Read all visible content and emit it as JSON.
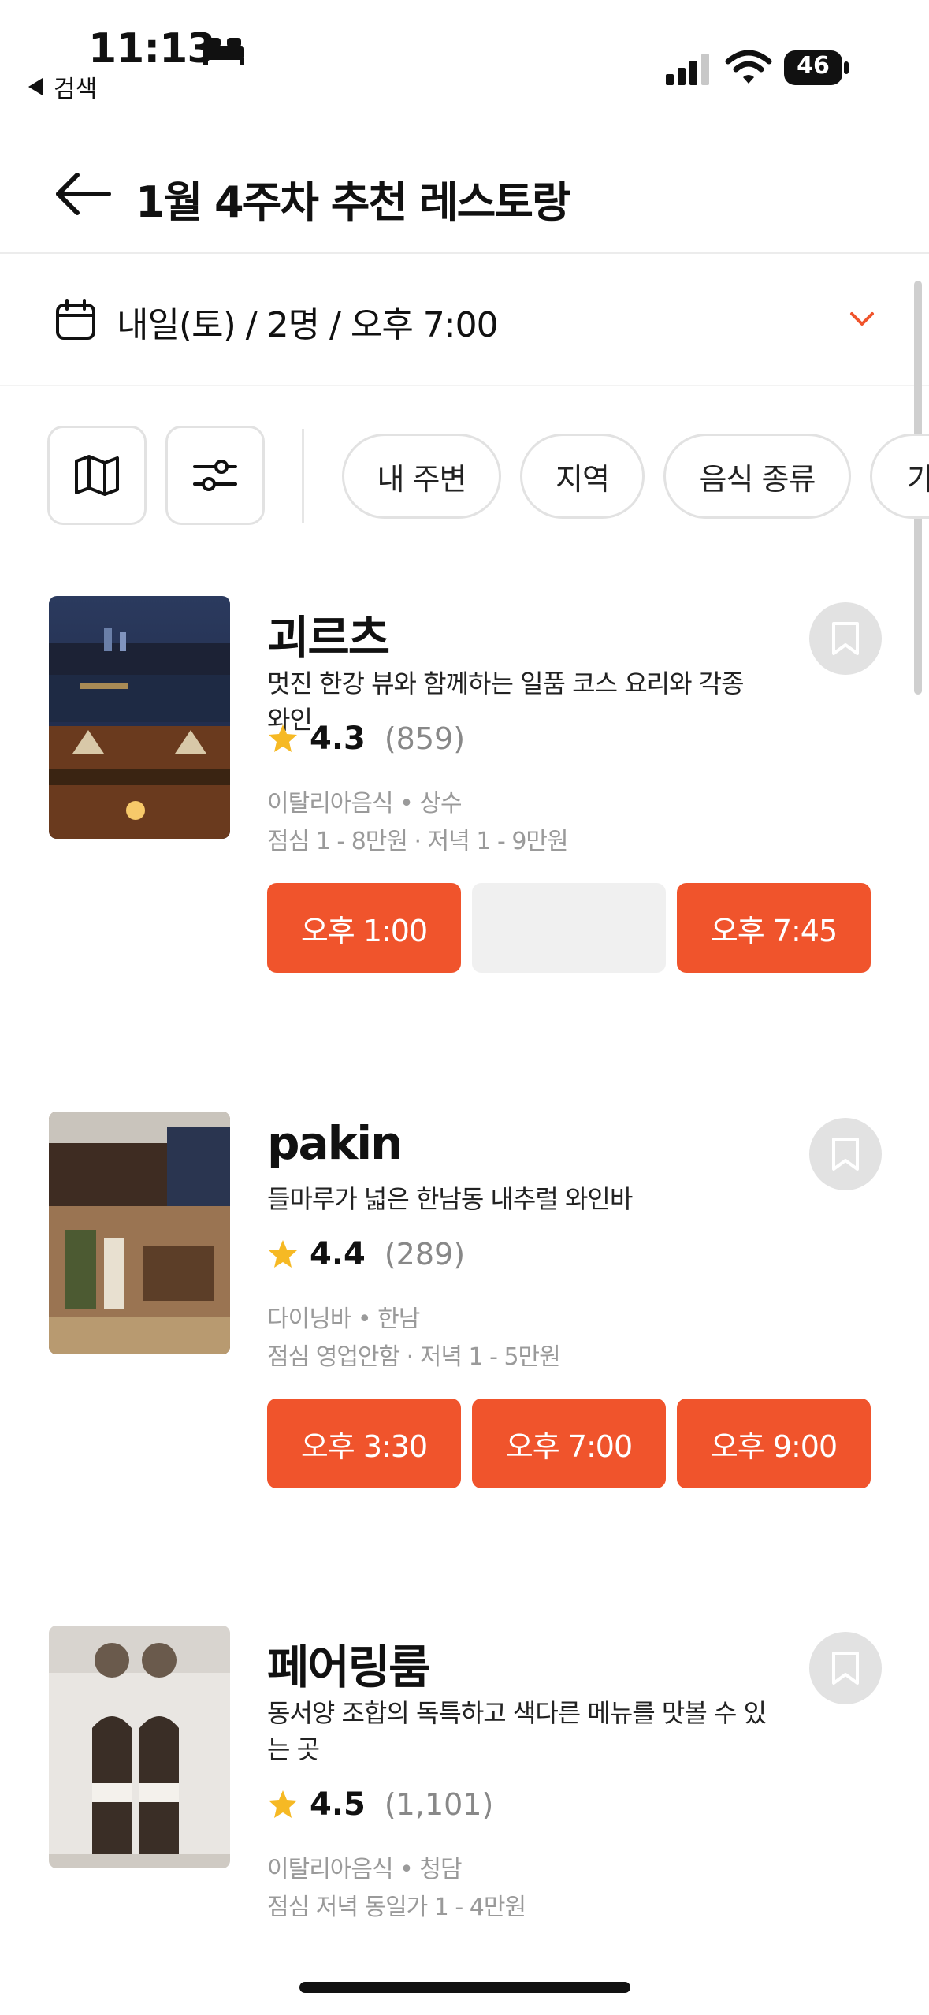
{
  "status_bar": {
    "time": "11:13",
    "back_app": "검색",
    "battery": "46",
    "icons": [
      "bed-icon",
      "signal-icon",
      "wifi-icon",
      "battery-icon"
    ]
  },
  "header": {
    "title": "1월 4주차 추천 레스토랑"
  },
  "date_bar": {
    "text": "내일(토) / 2명 / 오후 7:00"
  },
  "filters": {
    "chips": [
      "내 주변",
      "지역",
      "음식 종류",
      "가"
    ]
  },
  "colors": {
    "accent": "#f0542c",
    "star": "#f6b924",
    "muted": "#9a9a9a"
  },
  "restaurants": [
    {
      "name": "괴르츠",
      "description": "멋진 한강 뷰와 함께하는 일품 코스 요리와 각종 와인",
      "rating": "4.3",
      "reviews": "(859)",
      "category": "이탈리아음식 • 상수",
      "price": "점심 1 - 8만원 · 저녁 1 - 9만원",
      "slots": [
        "오후 1:00",
        "",
        "오후 7:45"
      ]
    },
    {
      "name": "pakin",
      "description": "들마루가 넓은 한남동 내추럴 와인바",
      "rating": "4.4",
      "reviews": "(289)",
      "category": "다이닝바 • 한남",
      "price": "점심 영업안함 · 저녁 1 - 5만원",
      "slots": [
        "오후 3:30",
        "오후 7:00",
        "오후 9:00"
      ]
    },
    {
      "name": "페어링룸",
      "description": "동서양 조합의 독특하고 색다른 메뉴를 맛볼 수 있는 곳",
      "rating": "4.5",
      "reviews": "(1,101)",
      "category": "이탈리아음식 • 청담",
      "price": "점심 저녁 동일가 1 - 4만원"
    }
  ]
}
